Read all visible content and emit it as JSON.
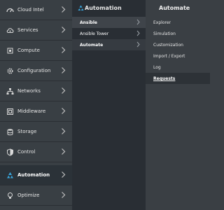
{
  "primary_nav": {
    "items": [
      {
        "label": "Cloud Intel",
        "icon": "dashboard-icon"
      },
      {
        "label": "Services",
        "icon": "cloud-gear-icon"
      },
      {
        "label": "Compute",
        "icon": "cpu-chip-icon"
      },
      {
        "label": "Configuration",
        "icon": "gear-icon"
      },
      {
        "label": "Networks",
        "icon": "network-icon"
      },
      {
        "label": "Middleware",
        "icon": "middleware-icon"
      },
      {
        "label": "Storage",
        "icon": "database-icon"
      },
      {
        "label": "Control",
        "icon": "shield-icon"
      },
      {
        "label": "Automation",
        "icon": "recycle-icon",
        "active": true
      },
      {
        "label": "Optimize",
        "icon": "lightbulb-icon"
      }
    ]
  },
  "secondary_nav": {
    "title": "Automation",
    "items": [
      {
        "label": "Ansible"
      },
      {
        "label": "Ansible Tower"
      },
      {
        "label": "Automate"
      }
    ]
  },
  "tertiary_nav": {
    "title": "Automate",
    "items": [
      {
        "label": "Explorer"
      },
      {
        "label": "Simulation"
      },
      {
        "label": "Customization"
      },
      {
        "label": "Import / Export"
      },
      {
        "label": "Log"
      },
      {
        "label": "Requests",
        "active": true
      }
    ]
  },
  "colors": {
    "active_icon": "#39a5dc",
    "primary_bg": "#393f44",
    "secondary_bg": "#292e34",
    "tertiary_bg": "#3a3f44"
  }
}
